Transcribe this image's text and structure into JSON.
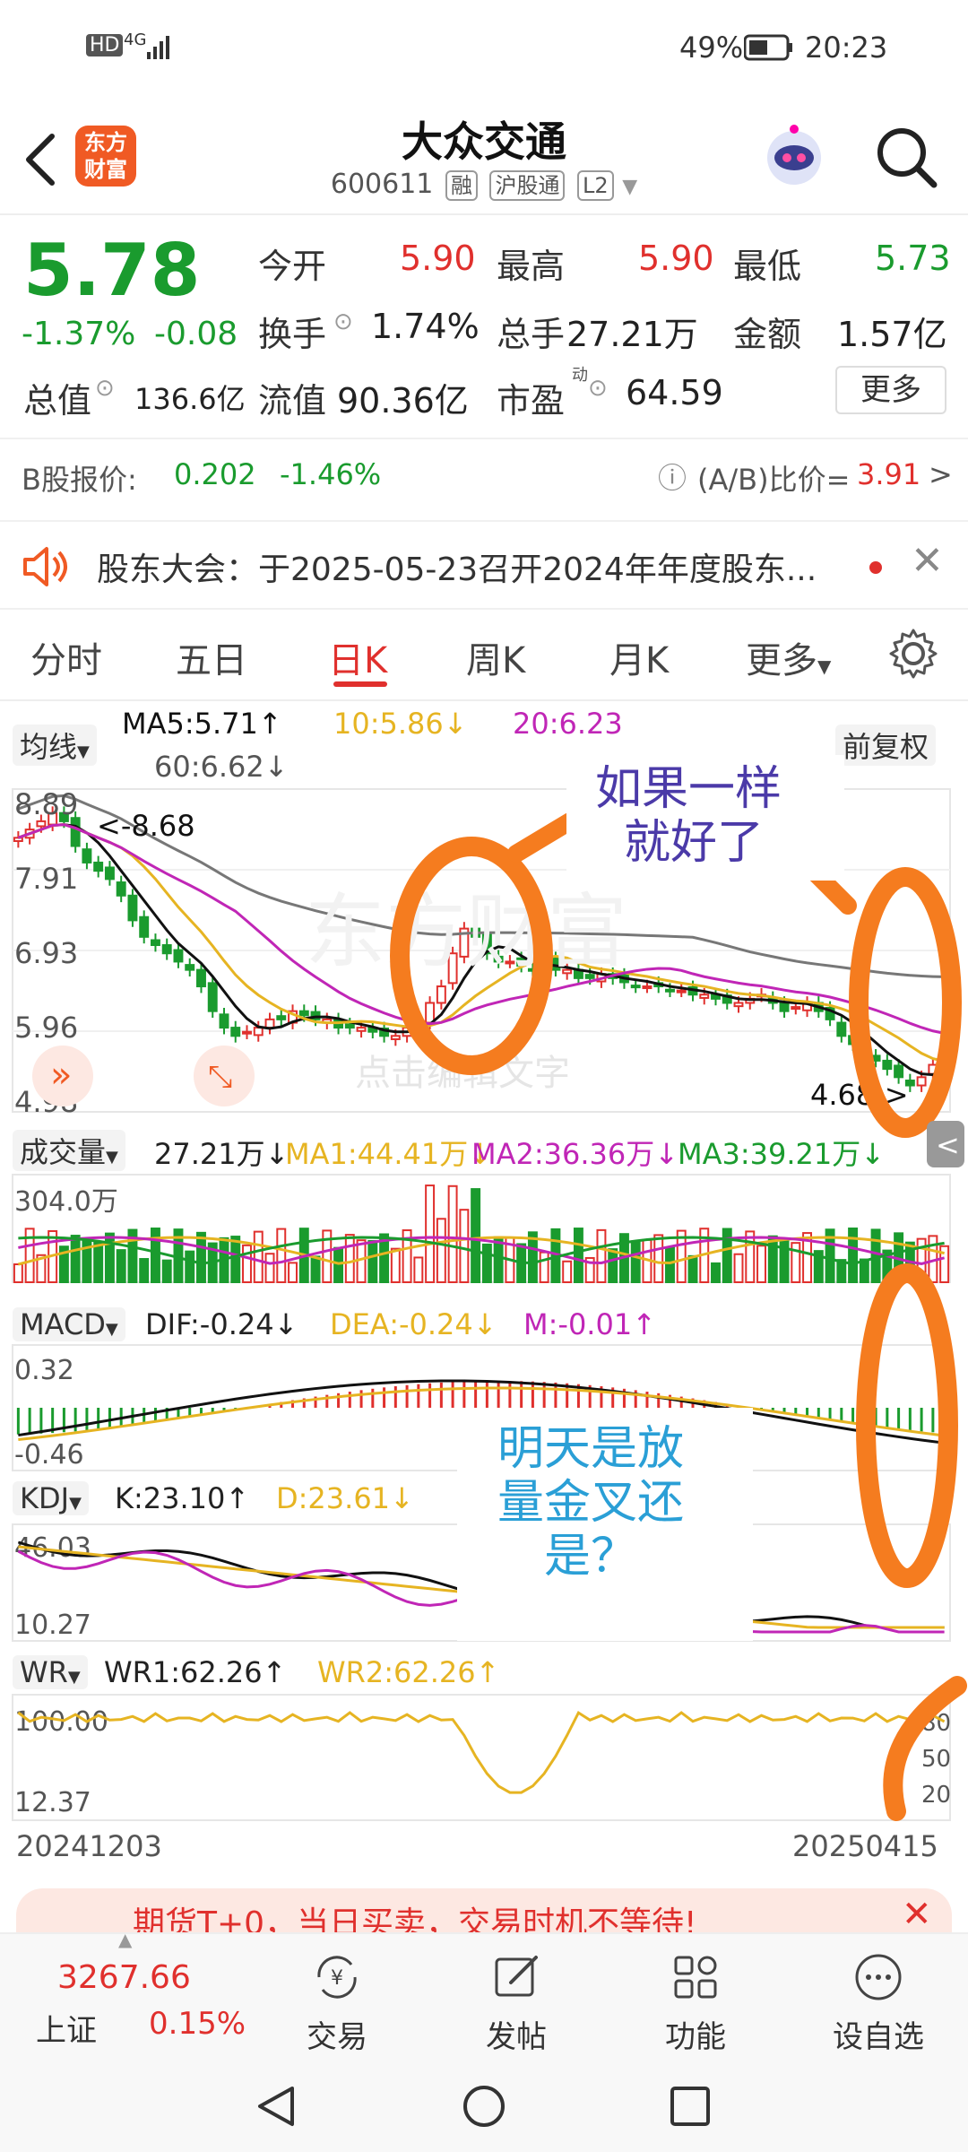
{
  "status_bar": {
    "network": "4G",
    "battery": "49%",
    "time": "20:23",
    "hd": "HD"
  },
  "header": {
    "logo_line1": "东方",
    "logo_line2": "财富",
    "title": "大众交通",
    "code": "600611",
    "tags": [
      "融",
      "沪股通",
      "L2"
    ]
  },
  "quote": {
    "price": "5.78",
    "change_pct": "-1.37%",
    "change": "-0.08",
    "open_label": "今开",
    "open": "5.90",
    "high_label": "最高",
    "high": "5.90",
    "low_label": "最低",
    "low": "5.73",
    "turnover_label": "换手",
    "turnover": "1.74%",
    "volume_label": "总手",
    "volume": "27.21万",
    "amount_label": "金额",
    "amount": "1.57亿",
    "mktcap_label": "总值",
    "mktcap": "136.6亿",
    "float_label": "流值",
    "float": "90.36亿",
    "pe_label": "市盈",
    "pe_sup": "动",
    "pe": "64.59",
    "more_label": "更多"
  },
  "b_share": {
    "label": "B股报价:",
    "price": "0.202",
    "pct": "-1.46%",
    "ratio_label": "(A/B)比价=",
    "ratio": "3.91",
    "arrow": ">"
  },
  "notice": {
    "text": "股东大会：于2025-05-23召开2024年年度股东..."
  },
  "tabs": [
    "分时",
    "五日",
    "日K",
    "周K",
    "月K",
    "更多"
  ],
  "active_tab": "日K",
  "kline": {
    "ma_selector": "均线",
    "ma5": "MA5:5.71",
    "ma10": "10:5.86",
    "ma20": "20:6.23",
    "ma60": "60:6.62",
    "adjust": "前复权",
    "y_labels": [
      "8.89",
      "7.91",
      "6.93",
      "5.96",
      "4.98"
    ],
    "high_marker": "<-8.68",
    "low_marker": "4.68->",
    "watermark": "东方财富",
    "edit_hint": "点击编辑文字",
    "colors": {
      "up": "#e0302d",
      "down": "#1a9b2e",
      "ma5": "#111111",
      "ma10": "#e6b422",
      "ma20": "#c026b6",
      "ma60": "#777777"
    }
  },
  "volume_panel": {
    "selector": "成交量",
    "value": "27.21万",
    "ma1": "MA1:44.41万",
    "ma2": "MA2:36.36万",
    "ma3": "MA3:39.21万",
    "max_label": "304.0万"
  },
  "macd_panel": {
    "selector": "MACD",
    "dif": "DIF:-0.24",
    "dea": "DEA:-0.24",
    "m": "M:-0.01",
    "top": "0.32",
    "bottom": "-0.46"
  },
  "kdj_panel": {
    "selector": "KDJ",
    "k": "K:23.10",
    "d": "D:23.61",
    "top": "46.03",
    "bottom": "10.27"
  },
  "wr_panel": {
    "selector": "WR",
    "wr1": "WR1:62.26",
    "wr2": "WR2:62.26",
    "top": "100.00",
    "bottom": "12.37",
    "right_labels": [
      "80",
      "50",
      "20"
    ]
  },
  "date_range": {
    "start": "20241203",
    "end": "20250415"
  },
  "annotations": {
    "note1_line1": "如果一样",
    "note1_line2": "就好了",
    "note2_line1": "明天是放",
    "note2_line2": "量金叉还",
    "note2_line3": "是？"
  },
  "ad_banner": {
    "text": "期货T+0，当日买卖，交易时机不等待!"
  },
  "bottom_nav": {
    "index_price": "3267.66",
    "index_name": "上证",
    "index_pct": "0.15%",
    "items": [
      "交易",
      "发帖",
      "功能",
      "设自选"
    ]
  }
}
